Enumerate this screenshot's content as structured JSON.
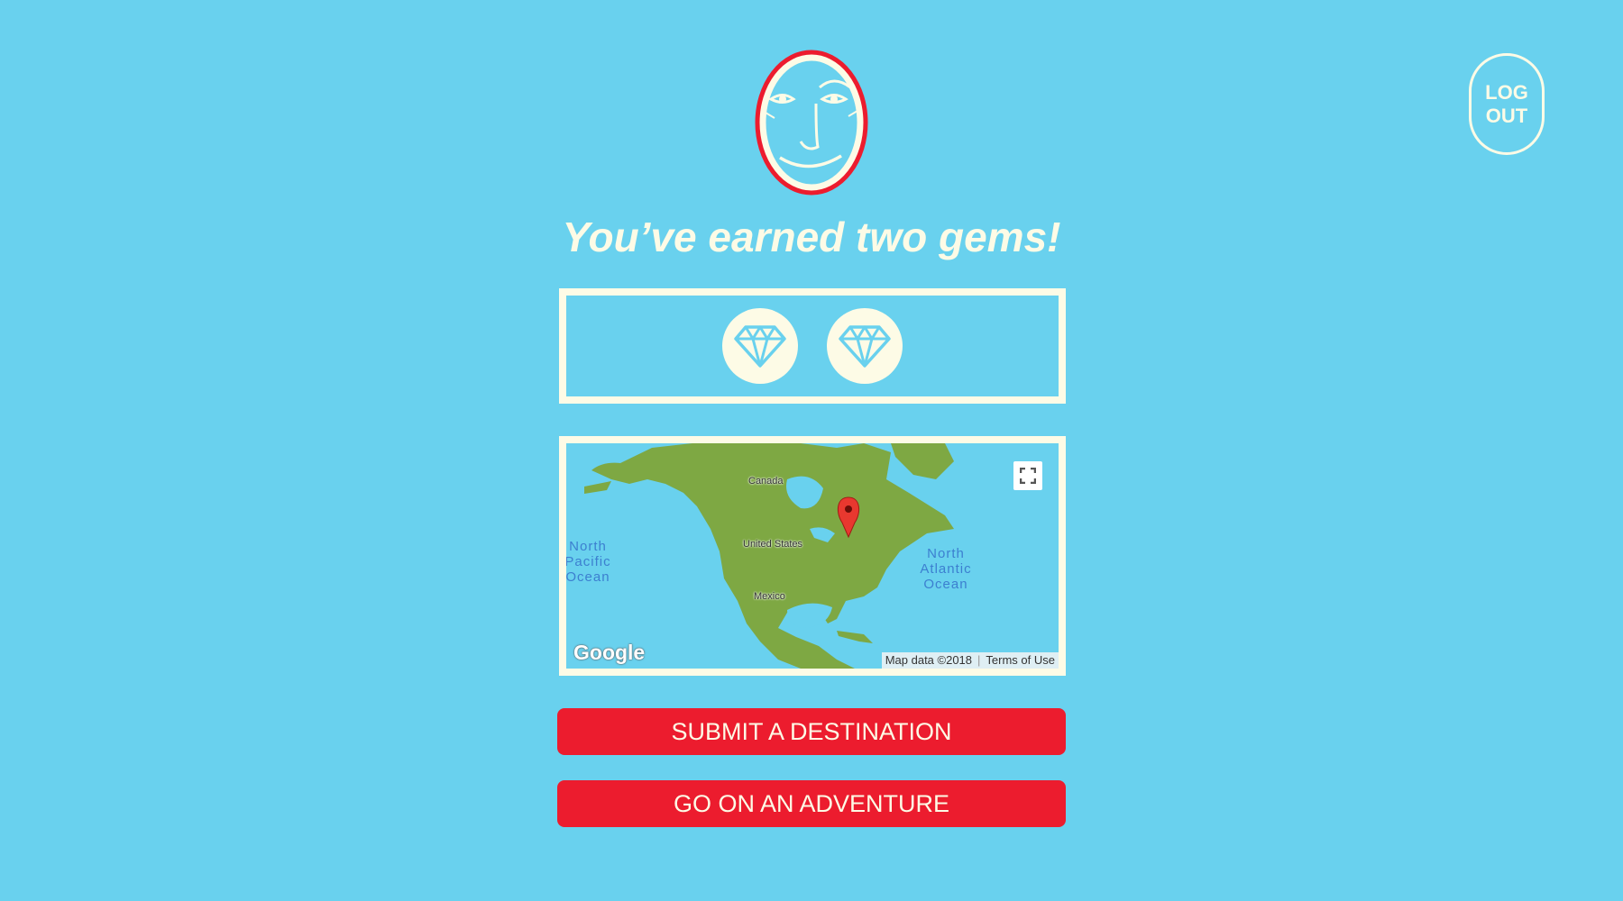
{
  "header": {
    "logout_line1": "LOG",
    "logout_line2": "OUT"
  },
  "headline": "You’ve earned two gems!",
  "gems": {
    "count": 2,
    "icon": "diamond-icon",
    "badge_color": "#fdfbe6",
    "icon_color": "#69d1ee"
  },
  "map": {
    "labels": {
      "canada": "Canada",
      "united_states": "United States",
      "mexico": "Mexico",
      "north_pacific": [
        "North",
        "Pacific",
        "Ocean"
      ],
      "north_atlantic": [
        "North",
        "Atlantic",
        "Ocean"
      ]
    },
    "google": "Google",
    "map_data": "Map data ©2018",
    "terms": "Terms of Use"
  },
  "actions": {
    "submit": "SUBMIT A DESTINATION",
    "adventure": "GO ON AN ADVENTURE"
  },
  "colors": {
    "background": "#69d1ee",
    "accent": "#ec1c2e",
    "cream": "#fdfbe6",
    "land": "#7ea843"
  }
}
